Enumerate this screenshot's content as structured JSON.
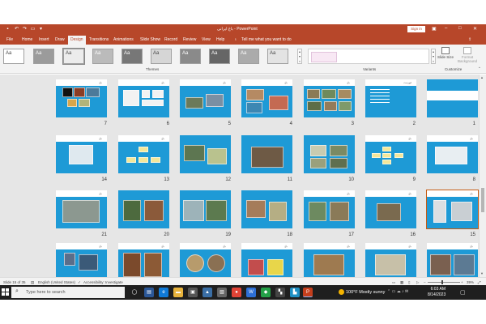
{
  "window": {
    "title": "باغ ایرانی  -  PowerPoint",
    "sign_in": "Sign in"
  },
  "menu": [
    "File",
    "Home",
    "Insert",
    "Draw",
    "Design",
    "Transitions",
    "Animations",
    "Slide Show",
    "Record",
    "Review",
    "View",
    "Help"
  ],
  "menu_active": "Design",
  "tell_me": "Tell me what you want to do",
  "ribbon": {
    "themes_label": "Themes",
    "variants_label": "Variants",
    "customize_label": "Customize",
    "theme_glyph": "Aa",
    "slide_size": "Slide Size",
    "format_background": "Format Background"
  },
  "slides": [
    {
      "num": "1"
    },
    {
      "num": "2"
    },
    {
      "num": "3"
    },
    {
      "num": "4"
    },
    {
      "num": "5"
    },
    {
      "num": "6"
    },
    {
      "num": "7"
    },
    {
      "num": "8"
    },
    {
      "num": "9"
    },
    {
      "num": "10"
    },
    {
      "num": "11"
    },
    {
      "num": "12"
    },
    {
      "num": "13"
    },
    {
      "num": "14"
    },
    {
      "num": "15"
    },
    {
      "num": "16"
    },
    {
      "num": "17"
    },
    {
      "num": "18"
    },
    {
      "num": "19"
    },
    {
      "num": "20"
    },
    {
      "num": "21"
    }
  ],
  "status": {
    "slide_of": "Slide 15 of 35",
    "language": "English (United States)",
    "accessibility": "Accessibility: Investigate",
    "zoom": "39%"
  },
  "taskbar": {
    "search_placeholder": "Type here to search",
    "weather": "100°F  Mostly sunny",
    "time": "6:03 AM",
    "date": "8/14/2023"
  },
  "colors": {
    "accent": "#b7472a",
    "slide_bg": "#1e9ad6",
    "taskbar": "#1f1f1f"
  }
}
